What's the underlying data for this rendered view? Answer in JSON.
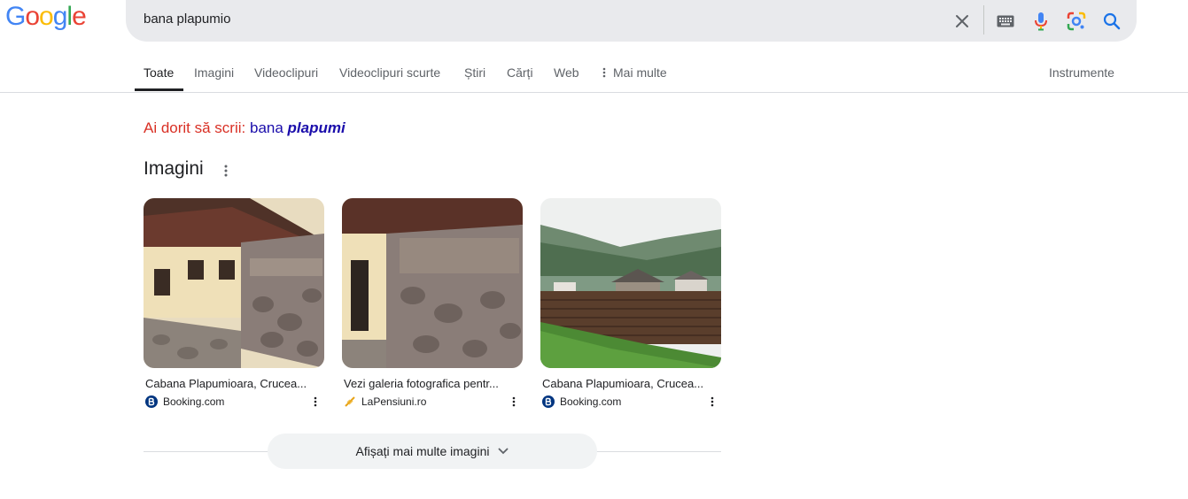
{
  "logo": {
    "letters": [
      "G",
      "o",
      "o",
      "g",
      "l",
      "e"
    ],
    "colors": [
      "#4285f4",
      "#ea4335",
      "#fbbc05",
      "#4285f4",
      "#34a853",
      "#ea4335"
    ]
  },
  "search": {
    "query": "bana plapumio"
  },
  "icons": {
    "clear": "close-icon",
    "keyboard": "keyboard-icon",
    "voice": "mic-icon",
    "lens": "google-lens-icon",
    "search": "search-icon"
  },
  "tabs": [
    {
      "label": "Toate"
    },
    {
      "label": "Imagini"
    },
    {
      "label": "Videoclipuri"
    },
    {
      "label": "Videoclipuri scurte"
    },
    {
      "label": "Știri"
    },
    {
      "label": "Cărți"
    },
    {
      "label": "Web"
    },
    {
      "label": "Mai multe"
    }
  ],
  "tools": {
    "label": "Instrumente"
  },
  "spelling": {
    "prefix": "Ai dorit să scrii:",
    "plain": "bana",
    "corrected": "plapumi"
  },
  "images_section": {
    "title": "Imagini",
    "cards": [
      {
        "title": "Cabana Plapumioara, Crucea...",
        "source": "Booking.com"
      },
      {
        "title": "Vezi galeria fotografica pentr...",
        "source": "LaPensiuni.ro"
      },
      {
        "title": "Cabana Plapumioara, Crucea...",
        "source": "Booking.com"
      }
    ],
    "more_button": "Afișați mai multe imagini"
  },
  "colors": {
    "booking_blue": "#003580",
    "link_blue": "#1a0dab",
    "spelling_red": "#d93025",
    "search_blue": "#1a73e8"
  }
}
